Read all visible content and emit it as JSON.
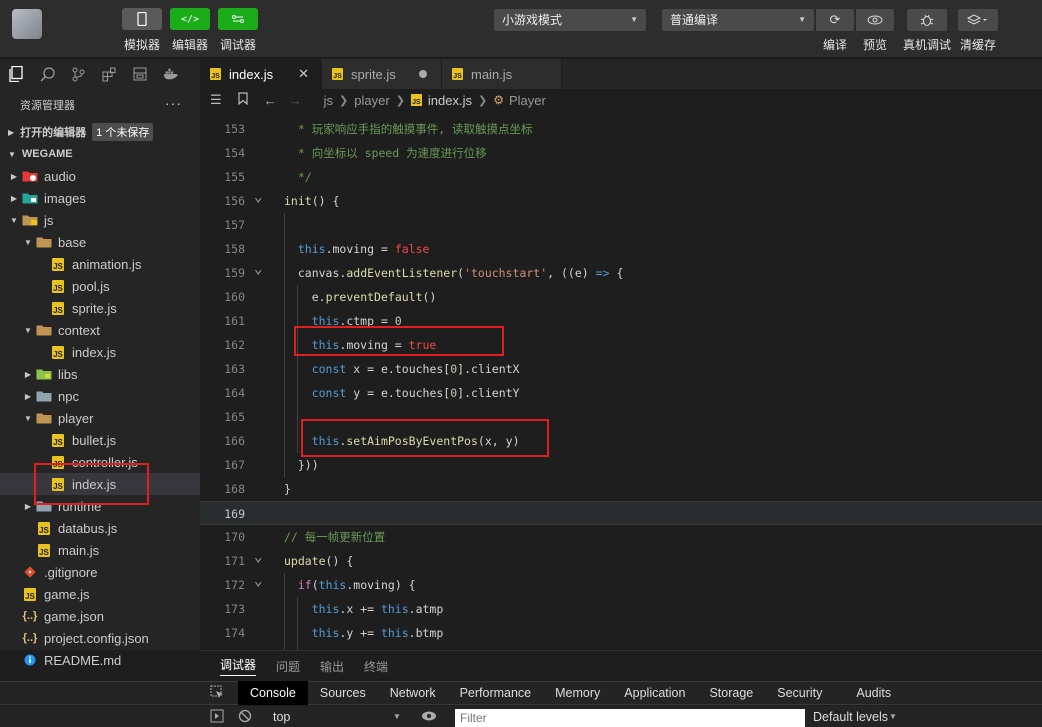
{
  "toolbar": {
    "simulator_label": "模拟器",
    "editor_label": "编辑器",
    "debugger_label": "调试器",
    "mode_select": "小游戏模式",
    "compile_select": "普通编译",
    "compile_label": "编译",
    "preview_label": "预览",
    "remote_debug_label": "真机调试",
    "clear_cache_label": "清缓存"
  },
  "sidebar": {
    "title": "资源管理器",
    "more": "···",
    "open_editors_label": "打开的编辑器",
    "unsaved_badge": "1 个未保存",
    "project_label": "WEGAME",
    "tree": [
      {
        "label": "audio",
        "type": "folder",
        "depth": 1,
        "open": false
      },
      {
        "label": "images",
        "type": "folder",
        "depth": 1,
        "open": false
      },
      {
        "label": "js",
        "type": "folder",
        "depth": 1,
        "open": true
      },
      {
        "label": "base",
        "type": "folder",
        "depth": 2,
        "open": true
      },
      {
        "label": "animation.js",
        "type": "js",
        "depth": 3
      },
      {
        "label": "pool.js",
        "type": "js",
        "depth": 3
      },
      {
        "label": "sprite.js",
        "type": "js",
        "depth": 3
      },
      {
        "label": "context",
        "type": "folder",
        "depth": 2,
        "open": true
      },
      {
        "label": "index.js",
        "type": "js",
        "depth": 3
      },
      {
        "label": "libs",
        "type": "folder",
        "depth": 2,
        "open": false
      },
      {
        "label": "npc",
        "type": "folder",
        "depth": 2,
        "open": false
      },
      {
        "label": "player",
        "type": "folder",
        "depth": 2,
        "open": true
      },
      {
        "label": "bullet.js",
        "type": "js",
        "depth": 3
      },
      {
        "label": "controller.js",
        "type": "js",
        "depth": 3
      },
      {
        "label": "index.js",
        "type": "js",
        "depth": 3,
        "selected": true
      },
      {
        "label": "runtime",
        "type": "folder",
        "depth": 2,
        "open": false
      },
      {
        "label": "databus.js",
        "type": "js",
        "depth": 2
      },
      {
        "label": "main.js",
        "type": "js",
        "depth": 2
      },
      {
        "label": ".gitignore",
        "type": "git",
        "depth": 1
      },
      {
        "label": "game.js",
        "type": "js",
        "depth": 1
      },
      {
        "label": "game.json",
        "type": "json",
        "depth": 1
      },
      {
        "label": "project.config.json",
        "type": "json",
        "depth": 1
      },
      {
        "label": "README.md",
        "type": "info",
        "depth": 1
      }
    ]
  },
  "tabs": [
    {
      "label": "index.js",
      "active": true,
      "state": "close"
    },
    {
      "label": "sprite.js",
      "active": false,
      "state": "dirty"
    },
    {
      "label": "main.js",
      "active": false,
      "state": "none"
    }
  ],
  "breadcrumb": [
    "js",
    "player",
    "index.js",
    "Player"
  ],
  "code": {
    "current_line": 169,
    "lines": [
      {
        "n": 153,
        "html": "<span class=\"cmt\">  * 玩家响应手指的触摸事件, 读取触摸点坐标</span>"
      },
      {
        "n": 154,
        "html": "<span class=\"cmt\">  * 向坐标以 speed 为速度进行位移</span>"
      },
      {
        "n": 155,
        "html": "<span class=\"cmt\">  */</span>"
      },
      {
        "n": 156,
        "fold": true,
        "html": "<span class=\"fn\">init</span>() {"
      },
      {
        "n": 157,
        "html": ""
      },
      {
        "n": 158,
        "html": "  <span class=\"kw\">this</span>.moving = <span class=\"bool\">false</span>"
      },
      {
        "n": 159,
        "fold": true,
        "html": "  <span class=\"ident\">canvas</span>.<span class=\"fn\">addEventListener</span>(<span class=\"str\">'touchstart'</span>, ((<span class=\"ident\">e</span>) <span class=\"kw\">=&gt;</span> {"
      },
      {
        "n": 160,
        "html": "    <span class=\"ident\">e</span>.<span class=\"fn\">preventDefault</span>()"
      },
      {
        "n": 161,
        "html": "    <span class=\"kw\">this</span>.ctmp = <span class=\"num\">0</span>"
      },
      {
        "n": 162,
        "html": "    <span class=\"kw\">this</span>.moving = <span class=\"bool\">true</span>"
      },
      {
        "n": 163,
        "html": "    <span class=\"kw\">const</span> <span class=\"ident\">x</span> = <span class=\"ident\">e</span>.touches[<span class=\"num\">0</span>].clientX"
      },
      {
        "n": 164,
        "html": "    <span class=\"kw\">const</span> <span class=\"ident\">y</span> = <span class=\"ident\">e</span>.touches[<span class=\"num\">0</span>].clientY"
      },
      {
        "n": 165,
        "html": ""
      },
      {
        "n": 166,
        "html": "    <span class=\"kw\">this</span>.<span class=\"fn\">setAimPosByEventPos</span>(<span class=\"ident\">x</span>, <span class=\"ident\">y</span>)"
      },
      {
        "n": 167,
        "html": "  }))"
      },
      {
        "n": 168,
        "html": "}"
      },
      {
        "n": 169,
        "html": ""
      },
      {
        "n": 170,
        "html": "<span class=\"cmt\">// 每一帧更新位置</span>"
      },
      {
        "n": 171,
        "fold": true,
        "html": "<span class=\"fn\">update</span>() {"
      },
      {
        "n": 172,
        "fold": true,
        "html": "  <span class=\"kw2\">if</span>(<span class=\"kw\">this</span>.moving) {"
      },
      {
        "n": 173,
        "html": "    <span class=\"kw\">this</span>.x += <span class=\"kw\">this</span>.atmp"
      },
      {
        "n": 174,
        "html": "    <span class=\"kw\">this</span>.y += <span class=\"kw\">this</span>.btmp"
      }
    ]
  },
  "panel": {
    "tabs": [
      "调试器",
      "问题",
      "输出",
      "终端"
    ],
    "devtools_tabs": [
      "Console",
      "Sources",
      "Network",
      "Performance",
      "Memory",
      "Application",
      "Storage",
      "Security",
      "Audits"
    ],
    "context_select": "top",
    "filter_placeholder": "Filter",
    "levels_label": "Default levels"
  }
}
